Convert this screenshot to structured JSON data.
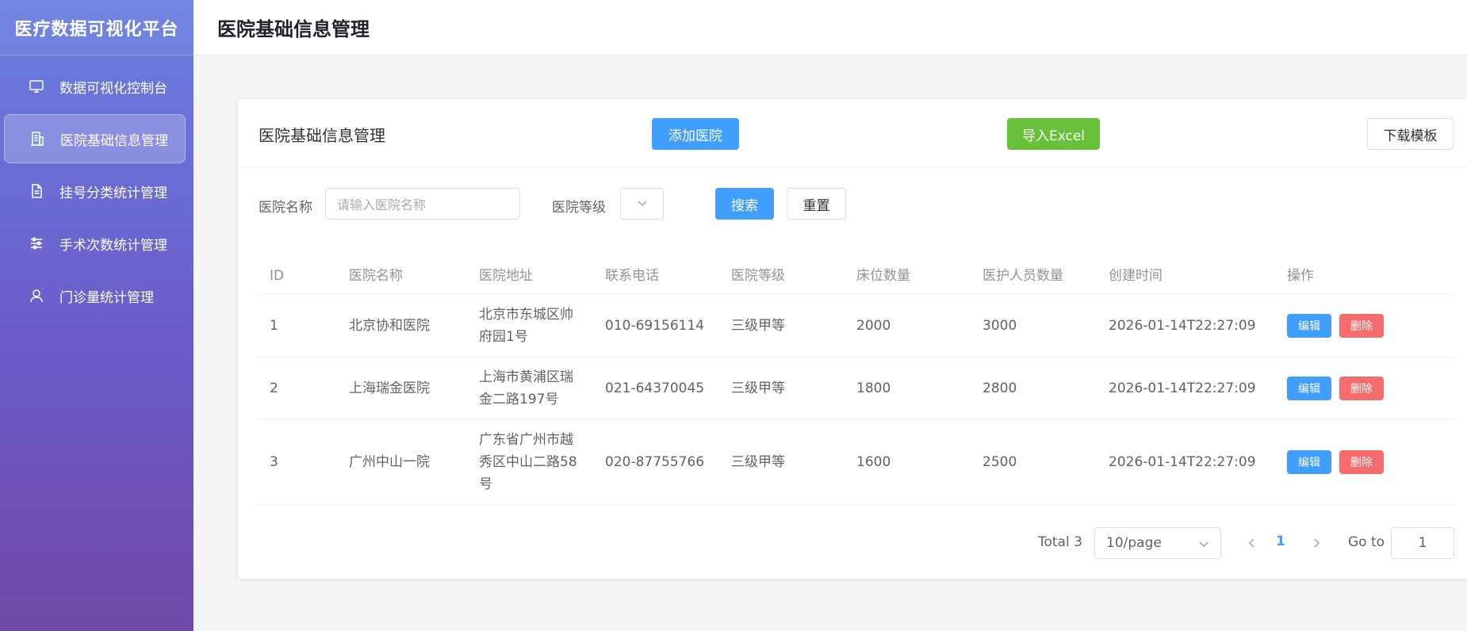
{
  "sidebar": {
    "brand": "医疗数据可视化平台",
    "items": [
      {
        "label": "数据可视化控制台",
        "icon": "monitor-icon"
      },
      {
        "label": "医院基础信息管理",
        "icon": "building-icon"
      },
      {
        "label": "挂号分类统计管理",
        "icon": "document-icon"
      },
      {
        "label": "手术次数统计管理",
        "icon": "sliders-icon"
      },
      {
        "label": "门诊量统计管理",
        "icon": "user-icon"
      }
    ],
    "active_index": 1
  },
  "header": {
    "title": "医院基础信息管理"
  },
  "card": {
    "title": "医院基础信息管理",
    "add_label": "添加医院",
    "import_label": "导入Excel",
    "template_label": "下载模板"
  },
  "search": {
    "name_label": "医院名称",
    "name_placeholder": "请输入医院名称",
    "level_label": "医院等级",
    "level_value": "",
    "search_label": "搜索",
    "reset_label": "重置"
  },
  "table": {
    "headers": [
      "ID",
      "医院名称",
      "医院地址",
      "联系电话",
      "医院等级",
      "床位数量",
      "医护人员数量",
      "创建时间",
      "操作"
    ],
    "edit_label": "编辑",
    "delete_label": "删除",
    "rows": [
      {
        "id": "1",
        "name": "北京协和医院",
        "address": "北京市东城区帅府园1号",
        "phone": "010-69156114",
        "level": "三级甲等",
        "beds": "2000",
        "staff": "3000",
        "created": "2026-01-14T22:27:09"
      },
      {
        "id": "2",
        "name": "上海瑞金医院",
        "address": "上海市黄浦区瑞金二路197号",
        "phone": "021-64370045",
        "level": "三级甲等",
        "beds": "1800",
        "staff": "2800",
        "created": "2026-01-14T22:27:09"
      },
      {
        "id": "3",
        "name": "广州中山一院",
        "address": "广东省广州市越秀区中山二路58号",
        "phone": "020-87755766",
        "level": "三级甲等",
        "beds": "1600",
        "staff": "2500",
        "created": "2026-01-14T22:27:09"
      }
    ]
  },
  "pagination": {
    "total": "Total 3",
    "page_size": "10/page",
    "current_page": "1",
    "goto_label": "Go to",
    "goto_value": "1"
  },
  "colors": {
    "primary": "#409eff",
    "success": "#67c23a",
    "danger": "#f56c6c"
  }
}
